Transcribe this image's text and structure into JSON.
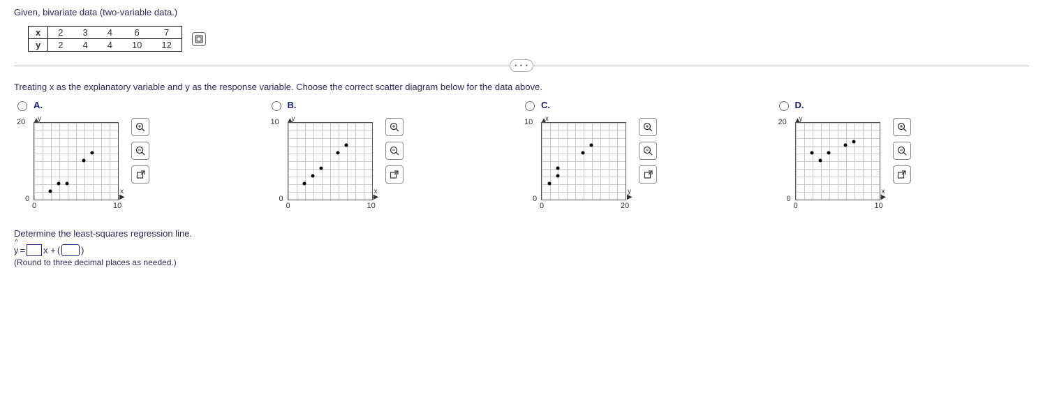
{
  "intro": "Given, bivariate data (two-variable data.)",
  "table": {
    "row_labels": [
      "x",
      "y"
    ],
    "x": [
      "2",
      "3",
      "4",
      "6",
      "7"
    ],
    "y": [
      "2",
      "4",
      "4",
      "10",
      "12"
    ]
  },
  "collapse_label": "• • •",
  "question": "Treating x as the explanatory variable and y as the response variable. Choose the correct scatter diagram below for the data above.",
  "options": {
    "A": {
      "label": "A.",
      "y_axis": "y",
      "x_axis": "x",
      "y_min": "0",
      "y_max": "20",
      "x_min": "0",
      "x_max": "10",
      "points": [
        [
          2,
          2
        ],
        [
          3,
          4
        ],
        [
          4,
          4
        ],
        [
          6,
          10
        ],
        [
          7,
          12
        ]
      ],
      "xrange": 10,
      "yrange": 20
    },
    "B": {
      "label": "B.",
      "y_axis": "y",
      "x_axis": "x",
      "y_min": "0",
      "y_max": "10",
      "x_min": "0",
      "x_max": "10",
      "points": [
        [
          2,
          2
        ],
        [
          3,
          3
        ],
        [
          4,
          4
        ],
        [
          6,
          6
        ],
        [
          7,
          7
        ]
      ],
      "xrange": 10,
      "yrange": 10
    },
    "C": {
      "label": "C.",
      "y_axis": "x",
      "x_axis": "y",
      "y_min": "0",
      "y_max": "10",
      "x_min": "0",
      "x_max": "20",
      "points": [
        [
          2,
          2
        ],
        [
          4,
          3
        ],
        [
          4,
          4
        ],
        [
          10,
          6
        ],
        [
          12,
          7
        ]
      ],
      "xrange": 20,
      "yrange": 10
    },
    "D": {
      "label": "D.",
      "y_axis": "y",
      "x_axis": "x",
      "y_min": "0",
      "y_max": "20",
      "x_min": "0",
      "x_max": "10",
      "points": [
        [
          2,
          12
        ],
        [
          3,
          10
        ],
        [
          4,
          12
        ],
        [
          6,
          14
        ],
        [
          7,
          15
        ]
      ],
      "xrange": 10,
      "yrange": 20
    }
  },
  "tools": {
    "zoom_in": "zoom-in",
    "zoom_out": "zoom-out",
    "popout": "open-new-window"
  },
  "subquestion": "Determine the least-squares regression line.",
  "equation": {
    "lhs": "y",
    "eq": " = ",
    "mid": "x + ",
    "open": "(",
    "close": ")"
  },
  "hint": "(Round to three decimal places as needed.)",
  "chart_data": {
    "type": "scatter",
    "title": "Bivariate data scatter options",
    "series": [
      {
        "name": "A",
        "x": [
          2,
          3,
          4,
          6,
          7
        ],
        "y": [
          2,
          4,
          4,
          10,
          12
        ],
        "xlim": [
          0,
          10
        ],
        "ylim": [
          0,
          20
        ],
        "xlabel": "x",
        "ylabel": "y"
      },
      {
        "name": "B",
        "x": [
          2,
          3,
          4,
          6,
          7
        ],
        "y": [
          2,
          3,
          4,
          6,
          7
        ],
        "xlim": [
          0,
          10
        ],
        "ylim": [
          0,
          10
        ],
        "xlabel": "x",
        "ylabel": "y"
      },
      {
        "name": "C",
        "x": [
          2,
          4,
          4,
          10,
          12
        ],
        "y": [
          2,
          3,
          4,
          6,
          7
        ],
        "xlim": [
          0,
          20
        ],
        "ylim": [
          0,
          10
        ],
        "xlabel": "y",
        "ylabel": "x"
      },
      {
        "name": "D",
        "x": [
          2,
          3,
          4,
          6,
          7
        ],
        "y": [
          12,
          10,
          12,
          14,
          15
        ],
        "xlim": [
          0,
          10
        ],
        "ylim": [
          0,
          20
        ],
        "xlabel": "x",
        "ylabel": "y"
      }
    ]
  }
}
